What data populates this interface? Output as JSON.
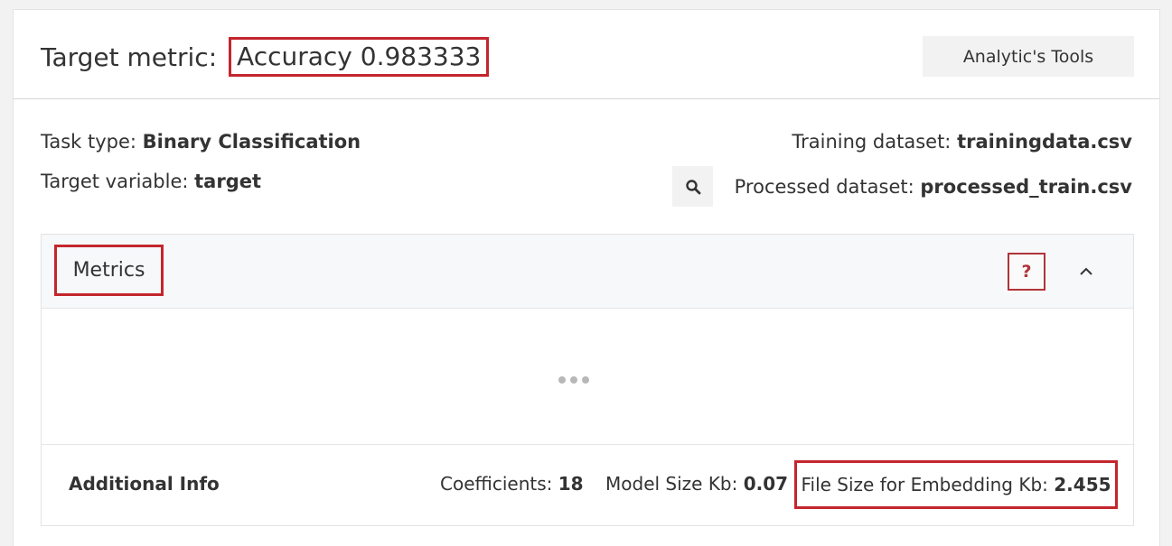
{
  "header": {
    "target_metric_label": "Target metric:",
    "target_metric_value": "Accuracy 0.983333",
    "tools_button": "Analytic's Tools"
  },
  "task": {
    "task_type_label": "Task type:",
    "task_type_value": "Binary Classification",
    "target_variable_label": "Target variable:",
    "target_variable_value": "target",
    "training_dataset_label": "Training dataset:",
    "training_dataset_value": "trainingdata.csv",
    "processed_dataset_label": "Processed dataset:",
    "processed_dataset_value": "processed_train.csv"
  },
  "metrics_panel": {
    "title": "Metrics",
    "help_label": "?"
  },
  "additional_info": {
    "title": "Additional Info",
    "coefficients_label": "Coefficients:",
    "coefficients_value": "18",
    "model_size_label": "Model Size Kb:",
    "model_size_value": "0.07",
    "file_size_label": "File Size for Embedding Kb:",
    "file_size_value": "2.455"
  },
  "icons": {
    "search": "search-icon",
    "collapse": "chevron-up-icon",
    "loading": "loading-dots-icon"
  },
  "colors": {
    "highlight": "#c4262e",
    "help": "#b0343a"
  }
}
